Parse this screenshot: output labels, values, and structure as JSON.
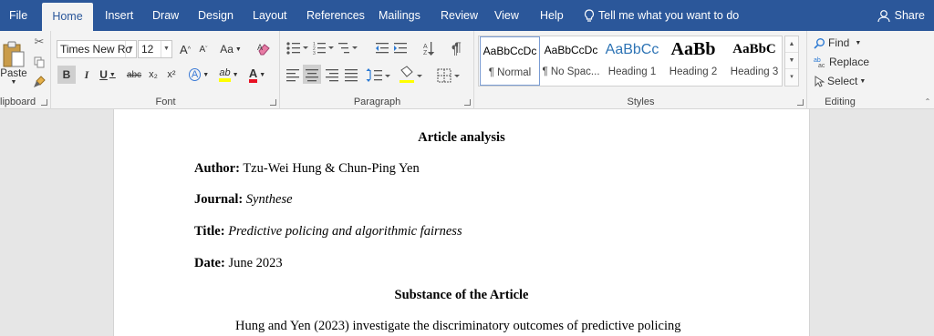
{
  "tabs": {
    "file": "File",
    "home": "Home",
    "insert": "Insert",
    "draw": "Draw",
    "design": "Design",
    "layout": "Layout",
    "references": "References",
    "mailings": "Mailings",
    "review": "Review",
    "view": "View",
    "help": "Help"
  },
  "tell_me": "Tell me what you want to do",
  "share": "Share",
  "clipboard": {
    "paste": "Paste",
    "label": "lipboard"
  },
  "font": {
    "name": "Times New Ro",
    "size": "12",
    "label": "Font",
    "grow": "A",
    "shrink": "A",
    "case": "Aa",
    "bold": "B",
    "italic": "I",
    "underline": "U",
    "strike": "abc",
    "subscript": "x₂",
    "superscript": "x²",
    "effects": "A",
    "highlight": "ab",
    "color": "A"
  },
  "paragraph": {
    "label": "Paragraph",
    "pilcrow": "¶"
  },
  "styles": {
    "label": "Styles",
    "items": [
      {
        "preview": "AaBbCcDc",
        "name": "¶ Normal"
      },
      {
        "preview": "AaBbCcDc",
        "name": "¶ No Spac..."
      },
      {
        "preview": "AaBbCc",
        "name": "Heading 1"
      },
      {
        "preview": "AaBb",
        "name": "Heading 2"
      },
      {
        "preview": "AaBbC",
        "name": "Heading 3"
      }
    ]
  },
  "editing": {
    "label": "Editing",
    "find": "Find",
    "replace": "Replace",
    "select": "Select"
  },
  "colors": {
    "accent": "#2b579a",
    "highlight": "#ffff00",
    "font_color": "#e81123"
  },
  "document": {
    "title": "Article analysis",
    "author_label": "Author:",
    "author": "Tzu-Wei Hung & Chun-Ping Yen",
    "journal_label": "Journal:",
    "journal": "Synthese",
    "title_label": "Title:",
    "article_title": "Predictive policing and algorithmic fairness",
    "date_label": "Date:",
    "date": "June 2023",
    "section_heading": "Substance of the Article",
    "body_line": "Hung and Yen (2023) investigate the discriminatory outcomes of predictive policing"
  }
}
